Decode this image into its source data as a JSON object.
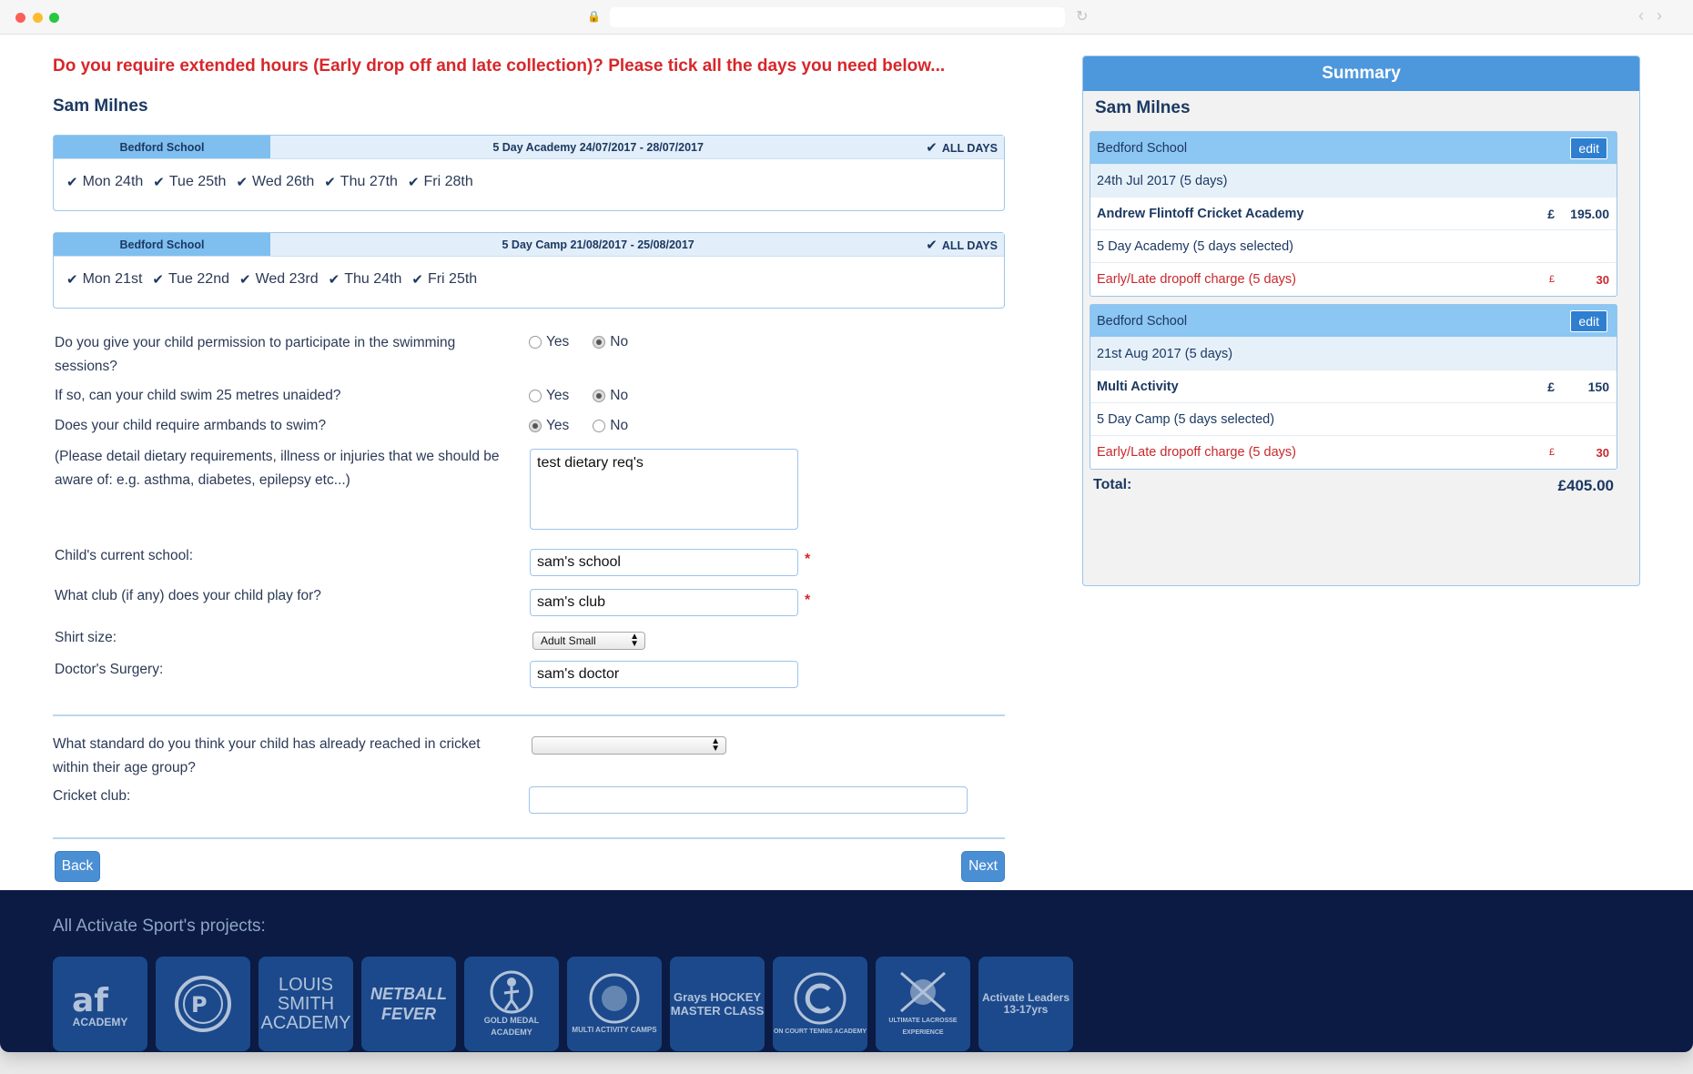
{
  "question": {
    "extended_hours": "Do you require extended hours (Early drop off and late collection)? Please tick all the days you need below...",
    "child_name": "Sam Milnes"
  },
  "bookings": [
    {
      "school": "Bedford School",
      "course": "5 Day Academy 24/07/2017 - 28/07/2017",
      "all_days": "ALL DAYS",
      "days": [
        "Mon 24th",
        "Tue 25th",
        "Wed 26th",
        "Thu 27th",
        "Fri 28th"
      ]
    },
    {
      "school": "Bedford School",
      "course": "5 Day Camp 21/08/2017 - 25/08/2017",
      "all_days": "ALL DAYS",
      "days": [
        "Mon 21st",
        "Tue 22nd",
        "Wed 23rd",
        "Thu 24th",
        "Fri 25th"
      ]
    }
  ],
  "form": {
    "swim_permission": {
      "label_line1": "Do you give your child permission to participate in the swimming",
      "label_line2": "sessions?",
      "yes": "Yes",
      "no": "No",
      "selected": "No"
    },
    "swim_25m": {
      "label": "If so, can your child swim 25 metres unaided?",
      "yes": "Yes",
      "no": "No",
      "selected": "No"
    },
    "armbands": {
      "label": "Does your child require armbands to swim?",
      "yes": "Yes",
      "no": "No",
      "selected": "Yes"
    },
    "dietary": {
      "label_line1": "(Please detail dietary requirements, illness or injuries that we should be",
      "label_line2": "aware of: e.g. asthma, diabetes, epilepsy etc...)",
      "value": "test dietary req's"
    },
    "school": {
      "label": "Child's current school:",
      "value": "sam's school"
    },
    "club": {
      "label": "What club (if any) does your child play for?",
      "value": "sam's club"
    },
    "shirt": {
      "label": "Shirt size:",
      "value": "Adult Small"
    },
    "doctor": {
      "label": "Doctor's Surgery:",
      "value": "sam's doctor"
    },
    "standard": {
      "label_line1": "What standard do you think your child has already reached in cricket",
      "label_line2": "within their age group?",
      "value": ""
    },
    "cricket_club": {
      "label": "Cricket club:",
      "value": ""
    },
    "required_mark": "*",
    "back_label": "Back",
    "next_label": "Next"
  },
  "summary": {
    "title": "Summary",
    "name": "Sam Milnes",
    "items": [
      {
        "school": "Bedford School",
        "edit": "edit",
        "date": "24th Jul 2017 (5 days)",
        "activity": "Andrew Flintoff Cricket Academy",
        "currency": "£",
        "price": "195.00",
        "detail": "5 Day Academy (5 days selected)",
        "extra_label": "Early/Late dropoff charge (5 days)",
        "extra_currency": "£",
        "extra_price": "30"
      },
      {
        "school": "Bedford School",
        "edit": "edit",
        "date": "21st Aug 2017 (5 days)",
        "activity": "Multi Activity",
        "currency": "£",
        "price": "150",
        "detail": "5 Day Camp (5 days selected)",
        "extra_label": "Early/Late dropoff charge (5 days)",
        "extra_currency": "£",
        "extra_price": "30"
      }
    ],
    "total_label": "Total:",
    "total_value": "£405.00"
  },
  "footer": {
    "title": "All Activate Sport's projects:",
    "tiles": [
      {
        "icon": "af-academy-logo",
        "text": "ACADEMY"
      },
      {
        "icon": "dp-roundel-logo",
        "text": ""
      },
      {
        "icon": "louis-smith-academy-logo",
        "text": "LOUIS SMITH ACADEMY"
      },
      {
        "icon": "netball-fever-logo",
        "text": "NETBALL FEVER"
      },
      {
        "icon": "gold-medal-academy-logo",
        "text": "GOLD MEDAL ACADEMY"
      },
      {
        "icon": "multi-activity-camps-logo",
        "text": "MULTI ACTIVITY CAMPS"
      },
      {
        "icon": "grays-hockey-masterclass-logo",
        "text": "Grays HOCKEY MASTER CLASS"
      },
      {
        "icon": "on-court-tennis-academy-logo",
        "text": "ON COURT TENNIS ACADEMY"
      },
      {
        "icon": "ultimate-lacrosse-experience-logo",
        "text": "ULTIMATE LACROSSE EXPERIENCE"
      },
      {
        "icon": "activate-leaders-logo",
        "text": "Activate Leaders 13-17yrs"
      }
    ]
  },
  "colors": {
    "heading_red": "#d8262a",
    "navy": "#1c3962",
    "button_blue": "#4a8fd4",
    "footer_bg": "#0b1b44"
  }
}
